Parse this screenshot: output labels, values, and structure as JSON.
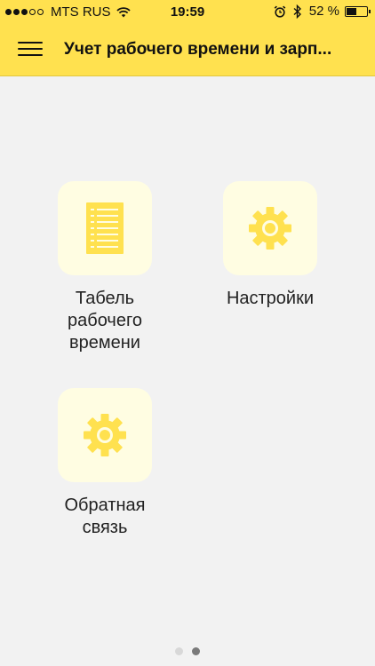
{
  "status_bar": {
    "carrier": "MTS RUS",
    "time": "19:59",
    "battery_percent": "52 %",
    "battery_level": 0.52,
    "signal_bars_filled": 3,
    "signal_bars_total": 5,
    "icons": [
      "wifi-icon",
      "alarm-icon",
      "bluetooth-icon",
      "battery-icon"
    ]
  },
  "header": {
    "title": "Учет рабочего времени и зарп...",
    "menu_icon": "hamburger-menu-icon"
  },
  "tiles": [
    {
      "label": "Табель\nрабочего\nвремени",
      "icon": "document-icon"
    },
    {
      "label": "Настройки",
      "icon": "gear-icon"
    },
    {
      "label": "Обратная\nсвязь",
      "icon": "gear-icon"
    }
  ],
  "page_indicator": {
    "total": 2,
    "current": 2
  },
  "colors": {
    "header_bg": "#ffe14f",
    "tile_bg": "#fffde2",
    "icon_yellow": "#ffe14f",
    "page_bg": "#f2f2f2"
  }
}
